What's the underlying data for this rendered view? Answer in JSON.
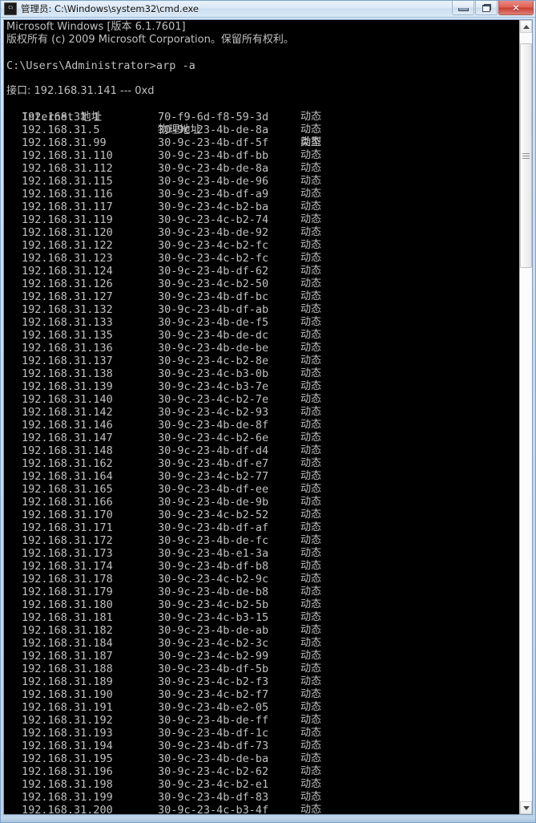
{
  "window": {
    "title": "管理员: C:\\Windows\\system32\\cmd.exe",
    "icon": "cmd-icon",
    "controls": {
      "minimize_label": "最小化",
      "restore_label": "向下还原",
      "close_label": "关闭",
      "close_glyph": "✕"
    },
    "accent_close_color": "#c83c30",
    "titlebar_color": "#dceaf7",
    "console_bg": "#000000",
    "console_fg": "#c0c0c0"
  },
  "console": {
    "header_lines": [
      "Microsoft Windows [版本 6.1.7601]",
      "版权所有 (c) 2009 Microsoft Corporation。保留所有权利。",
      "",
      "C:\\Users\\Administrator>arp -a",
      "",
      "接口: 192.168.31.141 --- 0xd"
    ],
    "prompt": "C:\\Users\\Administrator>",
    "command": "arp -a",
    "interface_ip": "192.168.31.141",
    "interface_index": "0xd",
    "columns": [
      "Internet 地址",
      "物理地址",
      "类型"
    ],
    "entries": [
      {
        "ip": "192.168.31.1",
        "mac": "70-f9-6d-f8-59-3d",
        "type": "动态"
      },
      {
        "ip": "192.168.31.5",
        "mac": "30-9c-23-4b-de-8a",
        "type": "动态"
      },
      {
        "ip": "192.168.31.99",
        "mac": "30-9c-23-4b-df-5f",
        "type": "动态"
      },
      {
        "ip": "192.168.31.110",
        "mac": "30-9c-23-4b-df-bb",
        "type": "动态"
      },
      {
        "ip": "192.168.31.112",
        "mac": "30-9c-23-4b-de-8a",
        "type": "动态"
      },
      {
        "ip": "192.168.31.115",
        "mac": "30-9c-23-4b-de-96",
        "type": "动态"
      },
      {
        "ip": "192.168.31.116",
        "mac": "30-9c-23-4b-df-a9",
        "type": "动态"
      },
      {
        "ip": "192.168.31.117",
        "mac": "30-9c-23-4c-b2-ba",
        "type": "动态"
      },
      {
        "ip": "192.168.31.119",
        "mac": "30-9c-23-4c-b2-74",
        "type": "动态"
      },
      {
        "ip": "192.168.31.120",
        "mac": "30-9c-23-4b-de-92",
        "type": "动态"
      },
      {
        "ip": "192.168.31.122",
        "mac": "30-9c-23-4c-b2-fc",
        "type": "动态"
      },
      {
        "ip": "192.168.31.123",
        "mac": "30-9c-23-4c-b2-fc",
        "type": "动态"
      },
      {
        "ip": "192.168.31.124",
        "mac": "30-9c-23-4b-df-62",
        "type": "动态"
      },
      {
        "ip": "192.168.31.126",
        "mac": "30-9c-23-4c-b2-50",
        "type": "动态"
      },
      {
        "ip": "192.168.31.127",
        "mac": "30-9c-23-4b-df-bc",
        "type": "动态"
      },
      {
        "ip": "192.168.31.132",
        "mac": "30-9c-23-4b-df-ab",
        "type": "动态"
      },
      {
        "ip": "192.168.31.133",
        "mac": "30-9c-23-4b-de-f5",
        "type": "动态"
      },
      {
        "ip": "192.168.31.135",
        "mac": "30-9c-23-4b-de-dc",
        "type": "动态"
      },
      {
        "ip": "192.168.31.136",
        "mac": "30-9c-23-4b-de-be",
        "type": "动态"
      },
      {
        "ip": "192.168.31.137",
        "mac": "30-9c-23-4c-b2-8e",
        "type": "动态"
      },
      {
        "ip": "192.168.31.138",
        "mac": "30-9c-23-4c-b3-0b",
        "type": "动态"
      },
      {
        "ip": "192.168.31.139",
        "mac": "30-9c-23-4c-b3-7e",
        "type": "动态"
      },
      {
        "ip": "192.168.31.140",
        "mac": "30-9c-23-4c-b2-7e",
        "type": "动态"
      },
      {
        "ip": "192.168.31.142",
        "mac": "30-9c-23-4c-b2-93",
        "type": "动态"
      },
      {
        "ip": "192.168.31.146",
        "mac": "30-9c-23-4b-de-8f",
        "type": "动态"
      },
      {
        "ip": "192.168.31.147",
        "mac": "30-9c-23-4c-b2-6e",
        "type": "动态"
      },
      {
        "ip": "192.168.31.148",
        "mac": "30-9c-23-4b-df-d4",
        "type": "动态"
      },
      {
        "ip": "192.168.31.162",
        "mac": "30-9c-23-4b-df-e7",
        "type": "动态"
      },
      {
        "ip": "192.168.31.164",
        "mac": "30-9c-23-4c-b2-77",
        "type": "动态"
      },
      {
        "ip": "192.168.31.165",
        "mac": "30-9c-23-4b-df-ee",
        "type": "动态"
      },
      {
        "ip": "192.168.31.166",
        "mac": "30-9c-23-4b-de-9b",
        "type": "动态"
      },
      {
        "ip": "192.168.31.170",
        "mac": "30-9c-23-4c-b2-52",
        "type": "动态"
      },
      {
        "ip": "192.168.31.171",
        "mac": "30-9c-23-4b-df-af",
        "type": "动态"
      },
      {
        "ip": "192.168.31.172",
        "mac": "30-9c-23-4b-de-fc",
        "type": "动态"
      },
      {
        "ip": "192.168.31.173",
        "mac": "30-9c-23-4b-e1-3a",
        "type": "动态"
      },
      {
        "ip": "192.168.31.174",
        "mac": "30-9c-23-4b-df-b8",
        "type": "动态"
      },
      {
        "ip": "192.168.31.178",
        "mac": "30-9c-23-4c-b2-9c",
        "type": "动态"
      },
      {
        "ip": "192.168.31.179",
        "mac": "30-9c-23-4b-de-b8",
        "type": "动态"
      },
      {
        "ip": "192.168.31.180",
        "mac": "30-9c-23-4c-b2-5b",
        "type": "动态"
      },
      {
        "ip": "192.168.31.181",
        "mac": "30-9c-23-4c-b3-15",
        "type": "动态"
      },
      {
        "ip": "192.168.31.182",
        "mac": "30-9c-23-4b-de-ab",
        "type": "动态"
      },
      {
        "ip": "192.168.31.184",
        "mac": "30-9c-23-4c-b2-3c",
        "type": "动态"
      },
      {
        "ip": "192.168.31.187",
        "mac": "30-9c-23-4c-b2-99",
        "type": "动态"
      },
      {
        "ip": "192.168.31.188",
        "mac": "30-9c-23-4b-df-5b",
        "type": "动态"
      },
      {
        "ip": "192.168.31.189",
        "mac": "30-9c-23-4c-b2-f3",
        "type": "动态"
      },
      {
        "ip": "192.168.31.190",
        "mac": "30-9c-23-4c-b2-f7",
        "type": "动态"
      },
      {
        "ip": "192.168.31.191",
        "mac": "30-9c-23-4b-e2-05",
        "type": "动态"
      },
      {
        "ip": "192.168.31.192",
        "mac": "30-9c-23-4b-de-ff",
        "type": "动态"
      },
      {
        "ip": "192.168.31.193",
        "mac": "30-9c-23-4b-df-1c",
        "type": "动态"
      },
      {
        "ip": "192.168.31.194",
        "mac": "30-9c-23-4b-df-73",
        "type": "动态"
      },
      {
        "ip": "192.168.31.195",
        "mac": "30-9c-23-4b-de-ba",
        "type": "动态"
      },
      {
        "ip": "192.168.31.196",
        "mac": "30-9c-23-4c-b2-62",
        "type": "动态"
      },
      {
        "ip": "192.168.31.198",
        "mac": "30-9c-23-4c-b2-e1",
        "type": "动态"
      },
      {
        "ip": "192.168.31.199",
        "mac": "30-9c-23-4b-df-83",
        "type": "动态"
      },
      {
        "ip": "192.168.31.200",
        "mac": "30-9c-23-4c-b3-4f",
        "type": "动态"
      }
    ]
  },
  "scrollbar": {
    "up_arrow": "scroll-up-icon",
    "down_arrow": "scroll-down-icon",
    "thumb": "scroll-thumb"
  }
}
